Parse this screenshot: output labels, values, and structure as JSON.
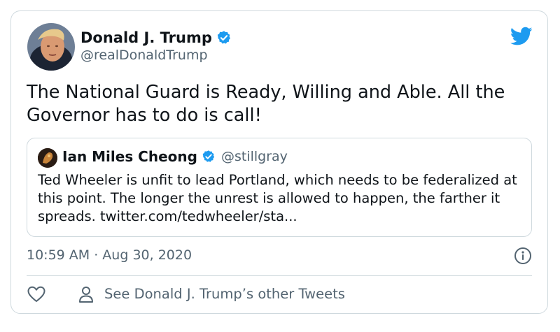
{
  "tweet": {
    "author": {
      "display_name": "Donald J. Trump",
      "handle": "@realDonaldTrump",
      "verified": true,
      "avatar_icon": "profile-photo"
    },
    "text": "The National Guard is Ready, Willing and Able. All the Governor has to do is call!",
    "quoted_tweet": {
      "author": {
        "display_name": "Ian Miles Cheong",
        "handle": "@stillgray",
        "verified": true,
        "avatar_icon": "profile-photo"
      },
      "text": "Ted Wheeler is unfit to lead Portland, which needs to be federalized at this point. The longer the unrest is allowed to happen, the farther it spreads. twitter.com/tedwheeler/sta..."
    },
    "timestamp": "10:59 AM · Aug 30, 2020",
    "actions": {
      "like_icon": "heart-icon",
      "info_icon": "info-icon",
      "other_tweets_label": "See Donald J. Trump’s other Tweets"
    }
  },
  "brand": {
    "logo_icon": "twitter-bird-icon",
    "accent_color": "#1d9bf0",
    "secondary_text_color": "#536471",
    "border_color": "#cfd9de"
  }
}
